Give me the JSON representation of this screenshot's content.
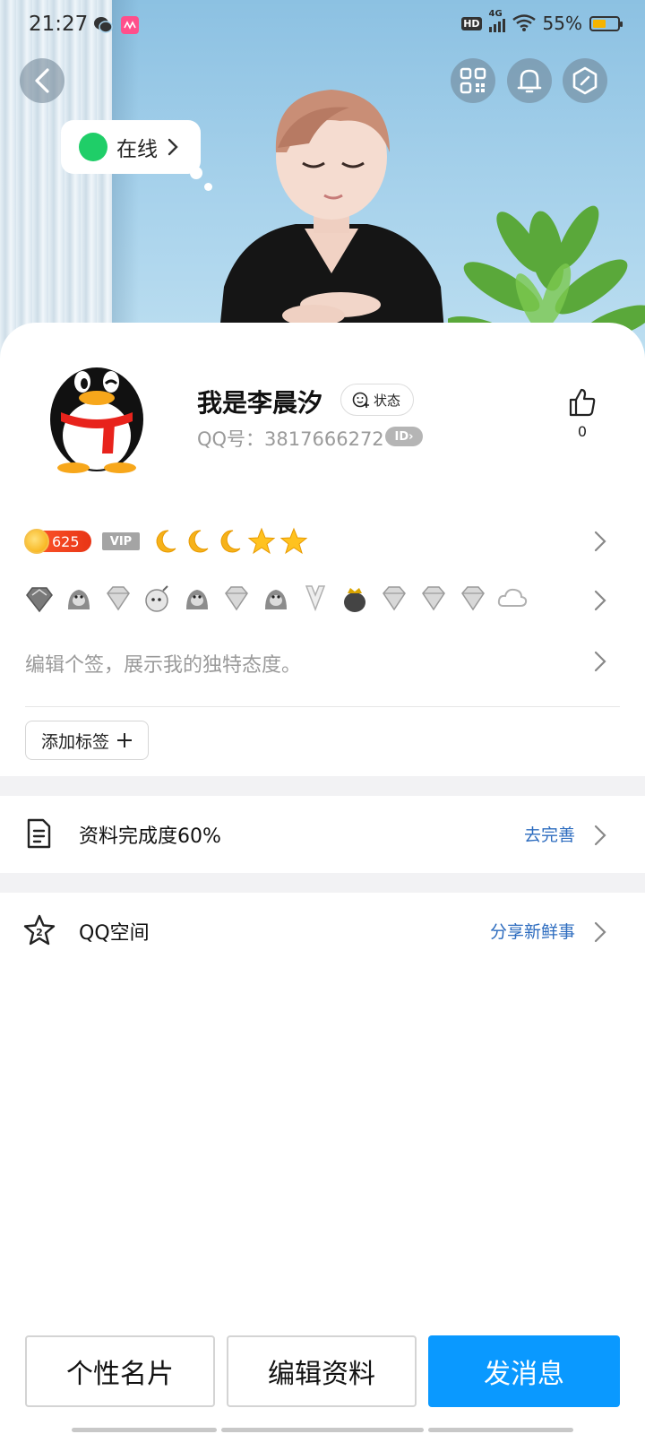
{
  "status_bar": {
    "time": "21:27",
    "network": "4G",
    "battery_percent": "55%",
    "battery_level": 0.55,
    "hd_label": "HD"
  },
  "header": {
    "online_status": "在线"
  },
  "profile": {
    "nickname": "我是李晨汐",
    "status_button": "状态",
    "qq_number_label": "QQ号：3817666272",
    "id_badge": "ID",
    "like_count": "0"
  },
  "level": {
    "points": "625",
    "vip_label": "VIP",
    "icons": [
      "moon-icon",
      "moon-icon",
      "moon-icon",
      "star-icon",
      "star-icon"
    ]
  },
  "badges": {
    "icons": [
      "crown-badge-icon",
      "penguin-badge-icon",
      "diamond-badge-icon",
      "bomb-badge-icon",
      "penguin-badge-icon",
      "diamond-badge-icon",
      "penguin-badge-icon",
      "suit-badge-icon",
      "crown-penguin-badge-icon",
      "diamond-badge-icon",
      "diamond-badge-icon",
      "diamond-badge-icon",
      "cloud-badge-icon"
    ]
  },
  "signature": {
    "placeholder": "编辑个签，展示我的独特态度。"
  },
  "tags": {
    "add_label": "添加标签"
  },
  "completion": {
    "label": "资料完成度60%",
    "action": "去完善"
  },
  "qzone": {
    "label": "QQ空间",
    "action": "分享新鲜事"
  },
  "footer": {
    "card_button": "个性名片",
    "edit_button": "编辑资料",
    "message_button": "发消息"
  },
  "colors": {
    "primary": "#0a99ff",
    "link": "#2d6cbf",
    "online": "#1fce68"
  }
}
